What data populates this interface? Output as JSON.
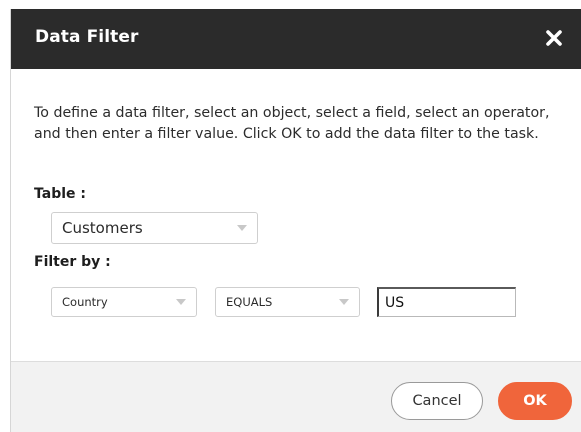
{
  "dialog": {
    "title": "Data Filter",
    "close_icon": "close-icon"
  },
  "body": {
    "description": "To define a data filter, select an object, select a field, select an operator, and then enter a filter value. Click OK to add the data filter to the task.",
    "table_label": "Table :",
    "table_select": {
      "value": "Customers",
      "icon": "chevron-down-icon"
    },
    "filter_label": "Filter by :",
    "field_select": {
      "value": "Country",
      "icon": "chevron-down-icon"
    },
    "operator_select": {
      "value": "EQUALS",
      "icon": "chevron-down-icon"
    },
    "filter_value": "US"
  },
  "footer": {
    "cancel_label": "Cancel",
    "ok_label": "OK"
  },
  "colors": {
    "header_bg": "#2b2b2b",
    "accent": "#f0653b",
    "footer_bg": "#f2f2f2"
  }
}
